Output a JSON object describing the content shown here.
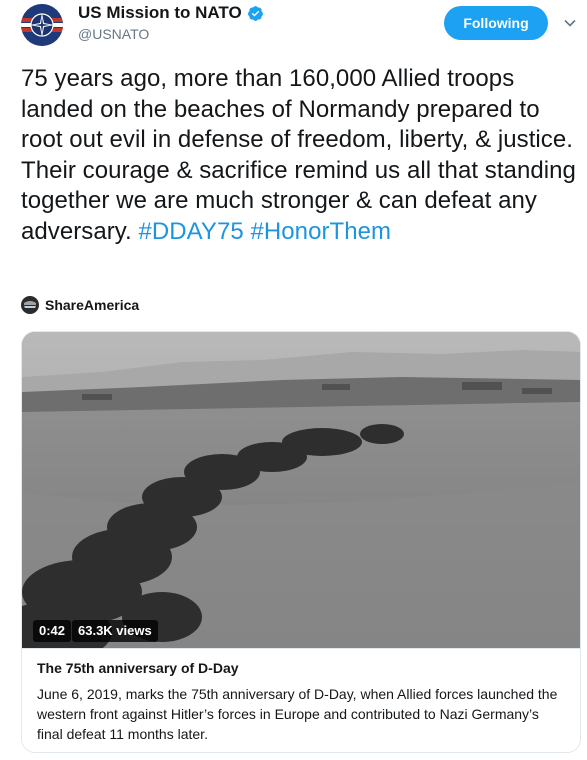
{
  "account": {
    "display_name": "US Mission to NATO",
    "handle": "@USNATO"
  },
  "follow_button": {
    "label": "Following"
  },
  "tweet": {
    "text": "75 years ago, more than 160,000 Allied troops landed on the beaches of Normandy prepared to root out evil in defense of freedom, liberty, & justice. Their courage & sacrifice remind us all that standing together we are much stronger & can defeat any adversary.",
    "hashtags": [
      "#DDAY75",
      "#HonorThem"
    ]
  },
  "source": {
    "name": "ShareAmerica"
  },
  "card": {
    "video_duration": "0:42",
    "video_views": "63.3K views",
    "title": "The 75th anniversary of D-Day",
    "description": "June 6, 2019, marks the 75th anniversary of D-Day, when Allied forces launched the western front against Hitler’s forces in Europe and contributed to Nazi Germany’s final defeat 11 months later."
  },
  "colors": {
    "accent": "#1da1f2",
    "hashtag": "#1b95e0",
    "muted": "#657786",
    "border": "#e1e8ed"
  },
  "icons": {
    "avatar": "nato-compass-star",
    "verified": "verified-badge-icon",
    "caret": "chevron-down-icon",
    "source": "shareamerica-logo-icon"
  }
}
